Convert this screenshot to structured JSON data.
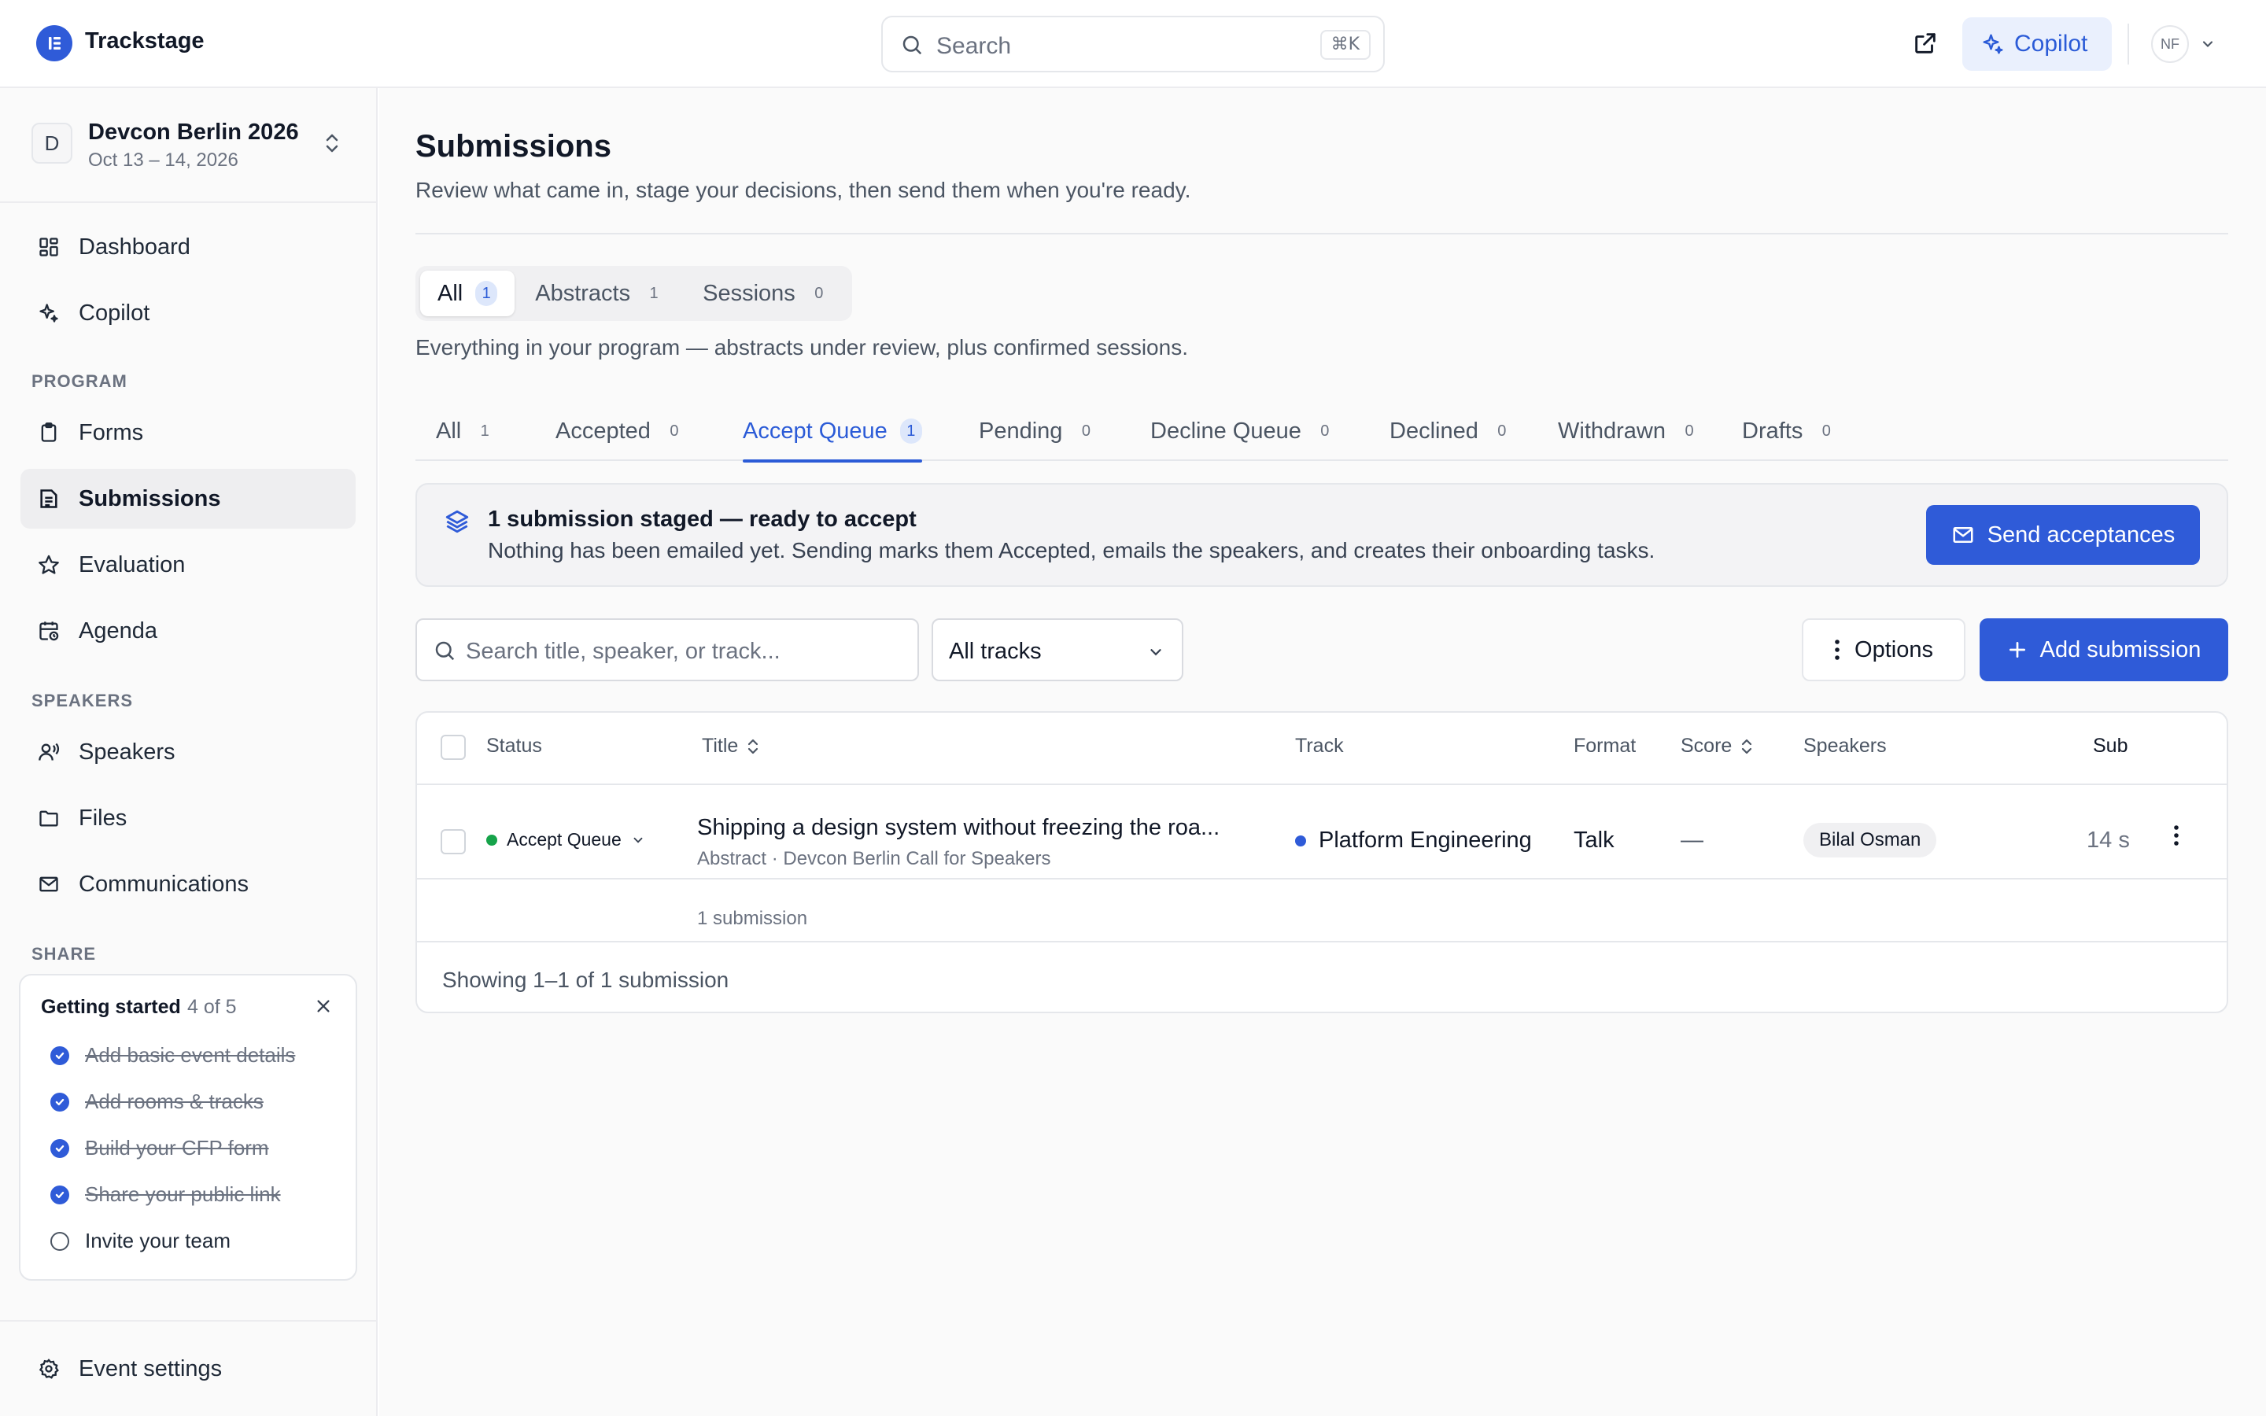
{
  "app": {
    "name": "Trackstage",
    "search_label": "Search",
    "search_shortcut": "⌘K",
    "copilot_label": "Copilot",
    "user_initials": "NF"
  },
  "event": {
    "badge": "D",
    "name": "Devcon Berlin 2026",
    "dates": "Oct 13 – 14, 2026"
  },
  "sidebar": {
    "top_items": [
      {
        "label": "Dashboard",
        "icon": "dashboard-icon"
      },
      {
        "label": "Copilot",
        "icon": "sparkle-icon"
      }
    ],
    "program_label": "PROGRAM",
    "program_items": [
      {
        "label": "Forms",
        "icon": "clipboard-icon"
      },
      {
        "label": "Submissions",
        "icon": "list-icon",
        "active": true
      },
      {
        "label": "Evaluation",
        "icon": "star-icon"
      },
      {
        "label": "Agenda",
        "icon": "calendar-clock-icon"
      }
    ],
    "speakers_label": "SPEAKERS",
    "speakers_items": [
      {
        "label": "Speakers",
        "icon": "speaker-icon"
      },
      {
        "label": "Files",
        "icon": "folder-icon"
      },
      {
        "label": "Communications",
        "icon": "mail-icon"
      }
    ],
    "share_label": "SHARE",
    "getting_started": {
      "title": "Getting started",
      "progress": "4 of 5",
      "items": [
        {
          "label": "Add basic event details",
          "done": true
        },
        {
          "label": "Add rooms & tracks",
          "done": true
        },
        {
          "label": "Build your CFP form",
          "done": true
        },
        {
          "label": "Share your public link",
          "done": true
        },
        {
          "label": "Invite your team",
          "done": false
        }
      ]
    },
    "settings_label": "Event settings"
  },
  "page": {
    "title": "Submissions",
    "subtitle": "Review what came in, stage your decisions, then send them when you're ready.",
    "segments": [
      {
        "label": "All",
        "count": "1",
        "active": true
      },
      {
        "label": "Abstracts",
        "count": "1"
      },
      {
        "label": "Sessions",
        "count": "0"
      }
    ],
    "segment_description": "Everything in your program — abstracts under review, plus confirmed sessions.",
    "tabs": [
      {
        "label": "All",
        "count": "1"
      },
      {
        "label": "Accepted",
        "count": "0"
      },
      {
        "label": "Accept Queue",
        "count": "1",
        "active": true
      },
      {
        "label": "Pending",
        "count": "0"
      },
      {
        "label": "Decline Queue",
        "count": "0"
      },
      {
        "label": "Declined",
        "count": "0"
      },
      {
        "label": "Withdrawn",
        "count": "0"
      },
      {
        "label": "Drafts",
        "count": "0"
      }
    ],
    "banner": {
      "title": "1 submission staged — ready to accept",
      "subtitle": "Nothing has been emailed yet. Sending marks them Accepted, emails the speakers, and creates their onboarding tasks.",
      "button": "Send acceptances"
    },
    "search_placeholder": "Search title, speaker, or track...",
    "track_filter": "All tracks",
    "options_label": "Options",
    "add_label": "Add submission"
  },
  "table": {
    "headers": {
      "status": "Status",
      "title": "Title",
      "track": "Track",
      "format": "Format",
      "score": "Score",
      "speakers": "Speakers",
      "submitted": "Sub"
    },
    "rows": [
      {
        "status": "Accept Queue",
        "title": "Shipping a design system without freezing the roa...",
        "subtitle": "Abstract · Devcon Berlin Call for Speakers",
        "track": "Platform Engineering",
        "format": "Talk",
        "score": "—",
        "speaker": "Bilal Osman",
        "submitted": "14 s"
      }
    ],
    "count_label": "1 submission",
    "footer": "Showing 1–1 of 1 submission"
  },
  "colors": {
    "accent": "#2f5bd8",
    "accent_light": "#eaf0fd",
    "status_green": "#16a34a"
  }
}
